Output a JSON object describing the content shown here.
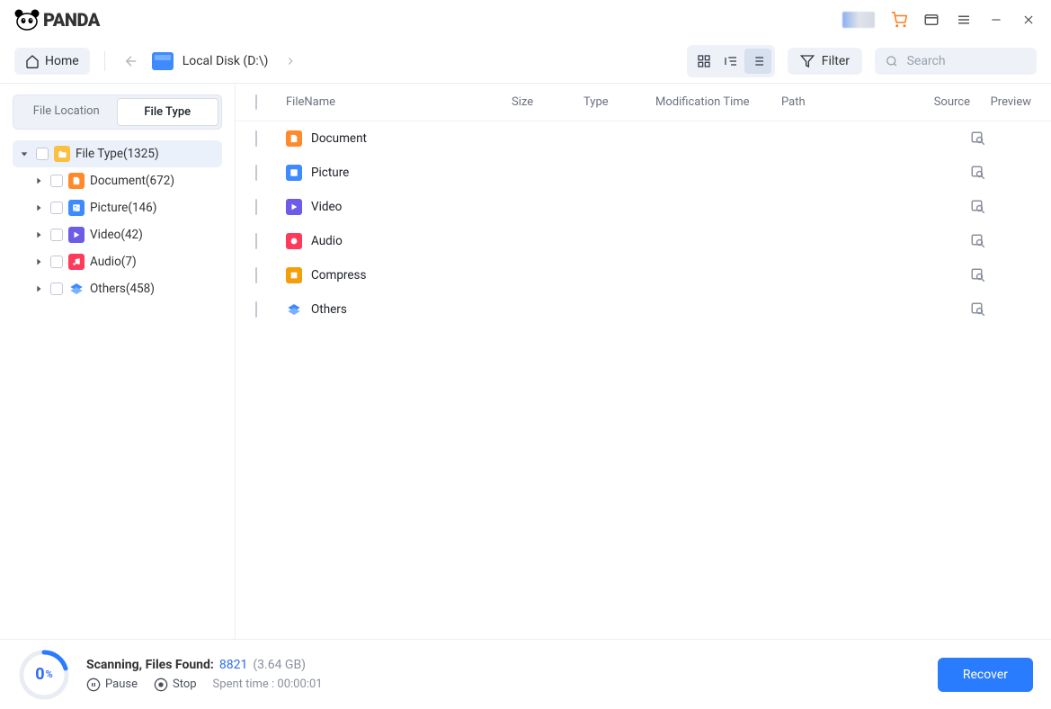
{
  "brand": "PANDA",
  "toolbar": {
    "home": "Home",
    "location": "Local Disk (D:\\)",
    "filter": "Filter",
    "search_placeholder": "Search"
  },
  "sidebar": {
    "tab_location": "File Location",
    "tab_type": "File Type",
    "root": "File Type(1325)",
    "items": [
      {
        "label": "Document(672)"
      },
      {
        "label": "Picture(146)"
      },
      {
        "label": "Video(42)"
      },
      {
        "label": "Audio(7)"
      },
      {
        "label": "Others(458)"
      }
    ]
  },
  "columns": {
    "name": "FileName",
    "size": "Size",
    "type": "Type",
    "mod": "Modification Time",
    "path": "Path",
    "src": "Source",
    "prev": "Preview"
  },
  "rows": [
    {
      "label": "Document"
    },
    {
      "label": "Picture"
    },
    {
      "label": "Video"
    },
    {
      "label": "Audio"
    },
    {
      "label": "Compress"
    },
    {
      "label": "Others"
    }
  ],
  "footer": {
    "percent": "0",
    "status_label": "Scanning, Files Found:",
    "count": "8821",
    "size": "(3.64 GB)",
    "pause": "Pause",
    "stop": "Stop",
    "spent": "Spent time : 00:00:01",
    "recover": "Recover"
  }
}
